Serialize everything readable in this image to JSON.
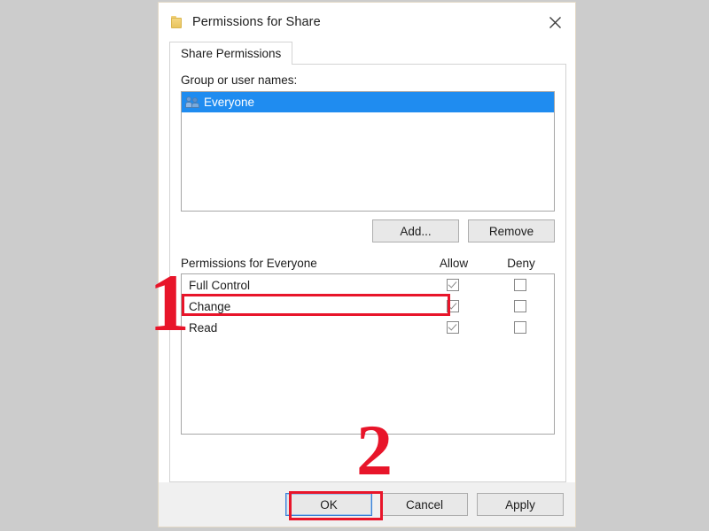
{
  "window": {
    "title": "Permissions for Share",
    "folder_icon": "folder-icon",
    "close_icon": "close-icon"
  },
  "tabs": [
    {
      "label": "Share Permissions",
      "active": true
    }
  ],
  "group_section": {
    "label": "Group or user names:",
    "items": [
      {
        "name": "Everyone",
        "icon": "users-group-icon",
        "selected": true
      }
    ],
    "buttons": {
      "add": "Add...",
      "remove": "Remove"
    }
  },
  "permissions_section": {
    "title": "Permissions for Everyone",
    "columns": [
      "Allow",
      "Deny"
    ],
    "rows": [
      {
        "name": "Full Control",
        "allow": true,
        "deny": false
      },
      {
        "name": "Change",
        "allow": true,
        "deny": false
      },
      {
        "name": "Read",
        "allow": true,
        "deny": false
      }
    ]
  },
  "footer": {
    "ok": "OK",
    "cancel": "Cancel",
    "apply": "Apply"
  },
  "annotations": {
    "step_one": "1",
    "step_two": "2",
    "color": "#e8152a"
  },
  "colors": {
    "selection_blue": "#1f8cf0",
    "annotation_red": "#e8152a",
    "page_background": "#cccccc",
    "dialog_background": "#ffffff",
    "footer_background": "#f0f0f0"
  }
}
